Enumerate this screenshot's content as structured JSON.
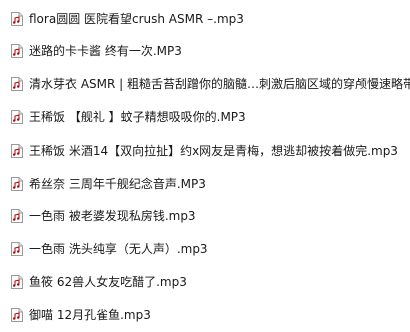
{
  "icon": "audio-file-icon",
  "files": [
    {
      "name": "flora圆圆  医院看望crush ASMR –.mp3"
    },
    {
      "name": "迷路的卡卡酱  终有一次.MP3"
    },
    {
      "name": "清水芽衣  ASMR | 粗糙舌苔刮蹭你的脑髓…刺激后脑区域的穿颅慢速略带"
    },
    {
      "name": "王稀饭  【舰礼 】蚊子精想吸吸你的.MP3"
    },
    {
      "name": "王稀饭  米酒14【双向拉扯】约x网友是青梅，想逃却被按着做完.mp3"
    },
    {
      "name": "希丝奈  三周年千舰纪念音声.MP3"
    },
    {
      "name": "一色雨  被老婆发现私房钱.mp3"
    },
    {
      "name": "一色雨  洗头纯享（无人声）.mp3"
    },
    {
      "name": "鱼筱  62兽人女友吃醋了.mp3"
    },
    {
      "name": "御喵  12月孔雀鱼.mp3"
    }
  ]
}
